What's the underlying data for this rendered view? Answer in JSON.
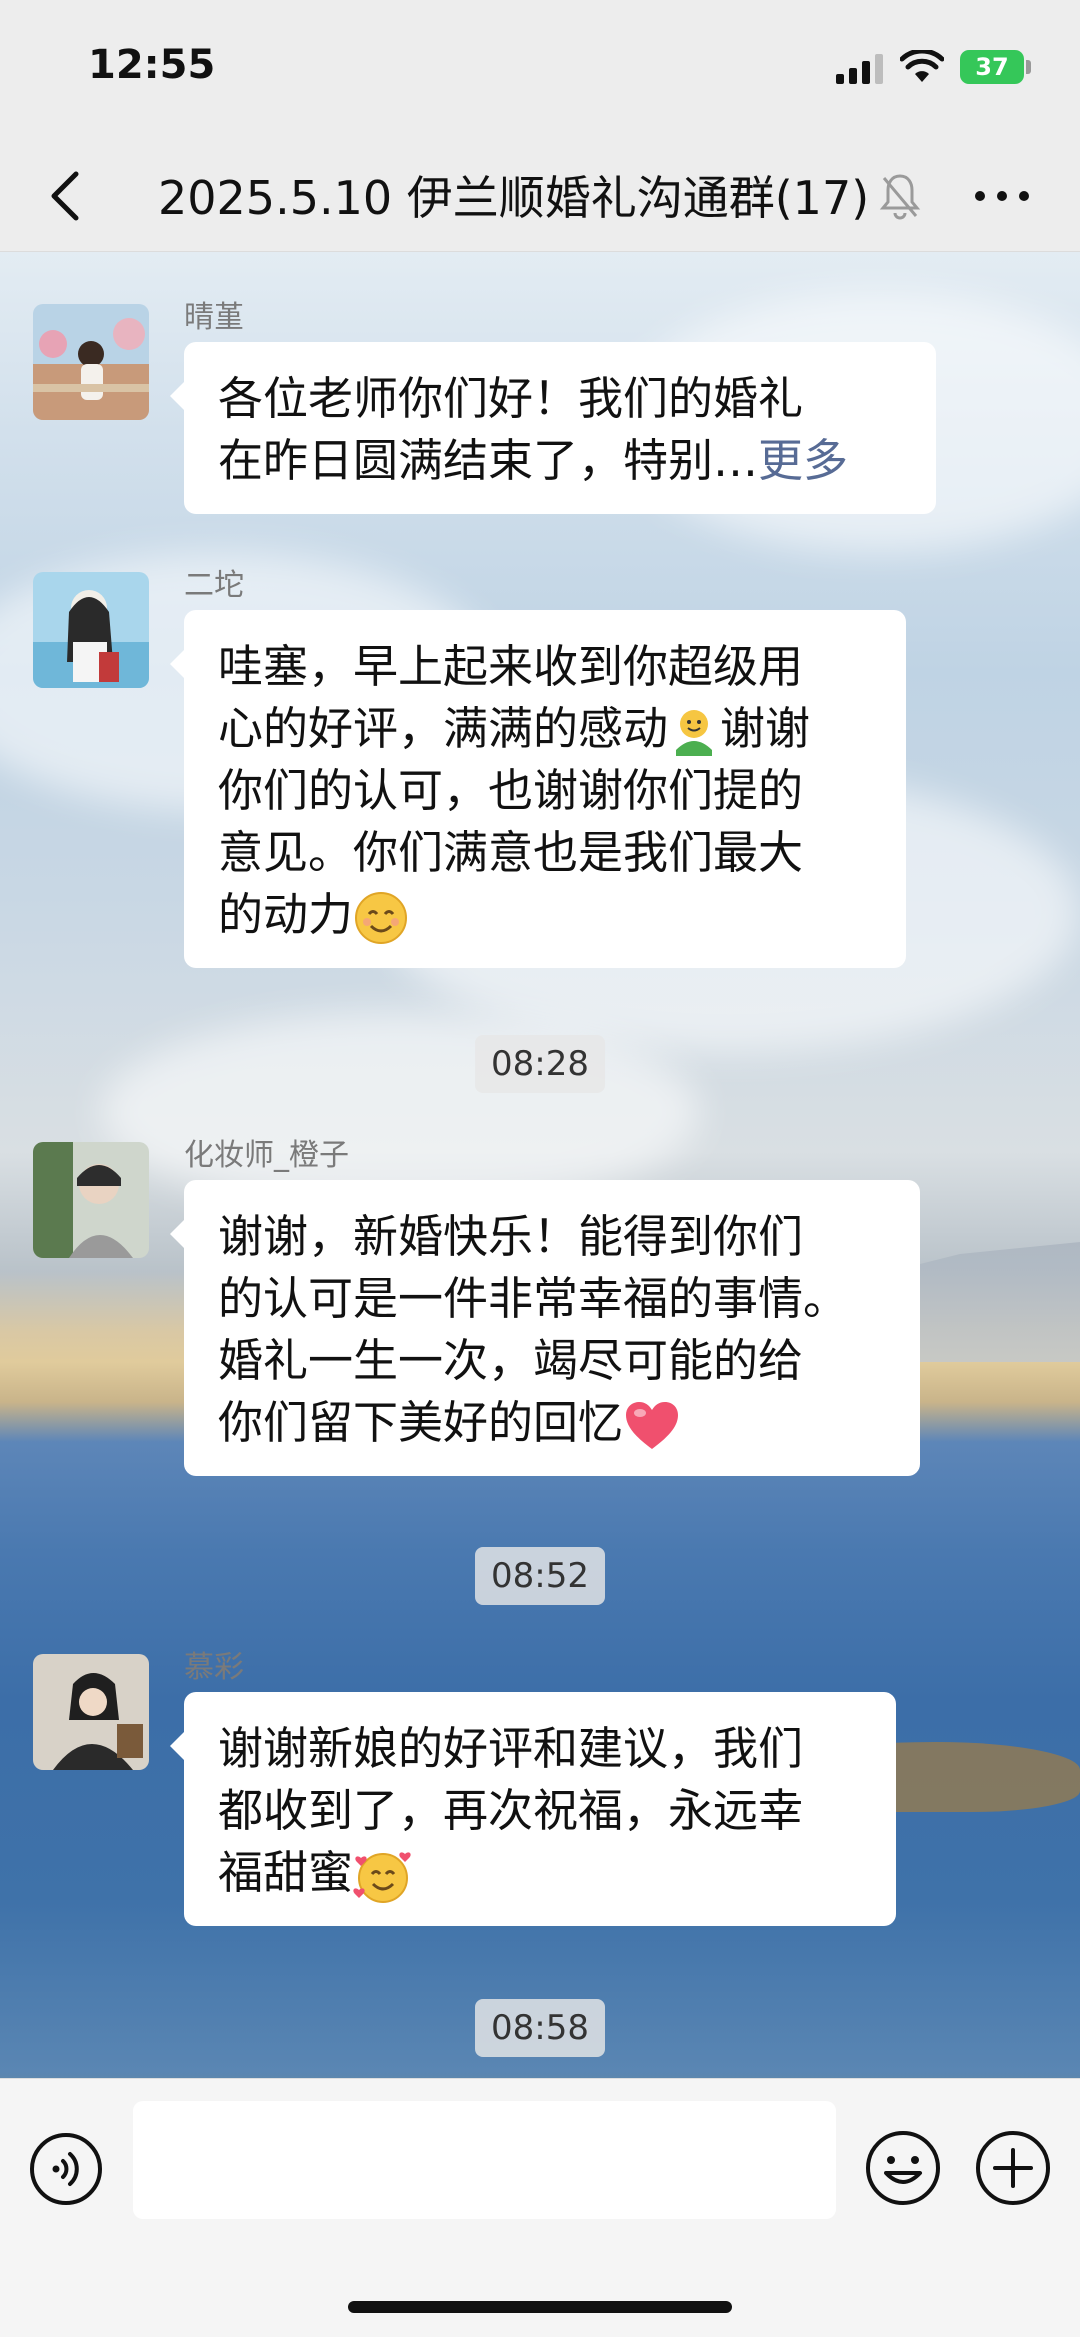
{
  "status_bar": {
    "time": "12:55",
    "battery": "37"
  },
  "header": {
    "title": "2025.5.10 伊兰顺婚礼沟通群(17)"
  },
  "messages": [
    {
      "sender": "晴堇",
      "lines": [
        "各位老师你们好！我们的婚礼",
        "在昨日圆满结束了，特别…"
      ],
      "more": "更多"
    },
    {
      "sender": "二坨",
      "lines": [
        "哇塞，早上起来收到你超级用",
        "心的好评，满满的感动",
        "谢谢",
        "你们的认可，也谢谢你们提的",
        "意见。你们满意也是我们最大",
        "的动力"
      ]
    },
    {
      "timestamp": "08:28",
      "sender": "化妆师_橙子",
      "lines": [
        "谢谢，新婚快乐！能得到你们",
        "的认可是一件非常幸福的事情。",
        "婚礼一生一次，竭尽可能的给",
        "你们留下美好的回忆"
      ]
    },
    {
      "timestamp": "08:52",
      "sender": "慕彩",
      "lines": [
        "谢谢新娘的好评和建议，我们",
        "都收到了，再次祝福，永远幸",
        "福甜蜜"
      ]
    }
  ],
  "last_timestamp": "08:58",
  "icons": {
    "back": "chevron-left-icon",
    "mute": "bell-slash-icon",
    "more": "more-dots-icon",
    "voice": "voice-icon",
    "emoji": "smile-icon",
    "plus": "plus-icon"
  },
  "colors": {
    "link": "#576b95",
    "bubble": "#ffffff",
    "battery": "#35c759"
  }
}
